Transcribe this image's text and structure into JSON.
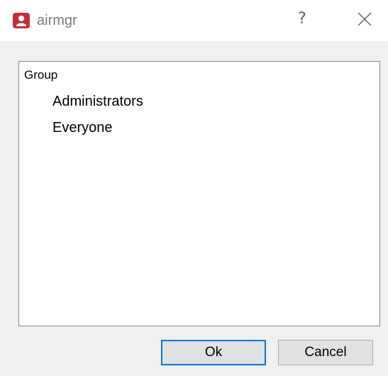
{
  "window": {
    "title": "airmgr",
    "help_glyph": "?",
    "icons": {
      "app": "app-icon",
      "close": "close-icon"
    },
    "accent_color": "#0078d7",
    "app_icon_color": "#c0303a"
  },
  "tree": {
    "root_label": "Group",
    "children": [
      {
        "label": "Administrators"
      },
      {
        "label": "Everyone"
      }
    ]
  },
  "buttons": {
    "ok_label": "Ok",
    "cancel_label": "Cancel"
  }
}
